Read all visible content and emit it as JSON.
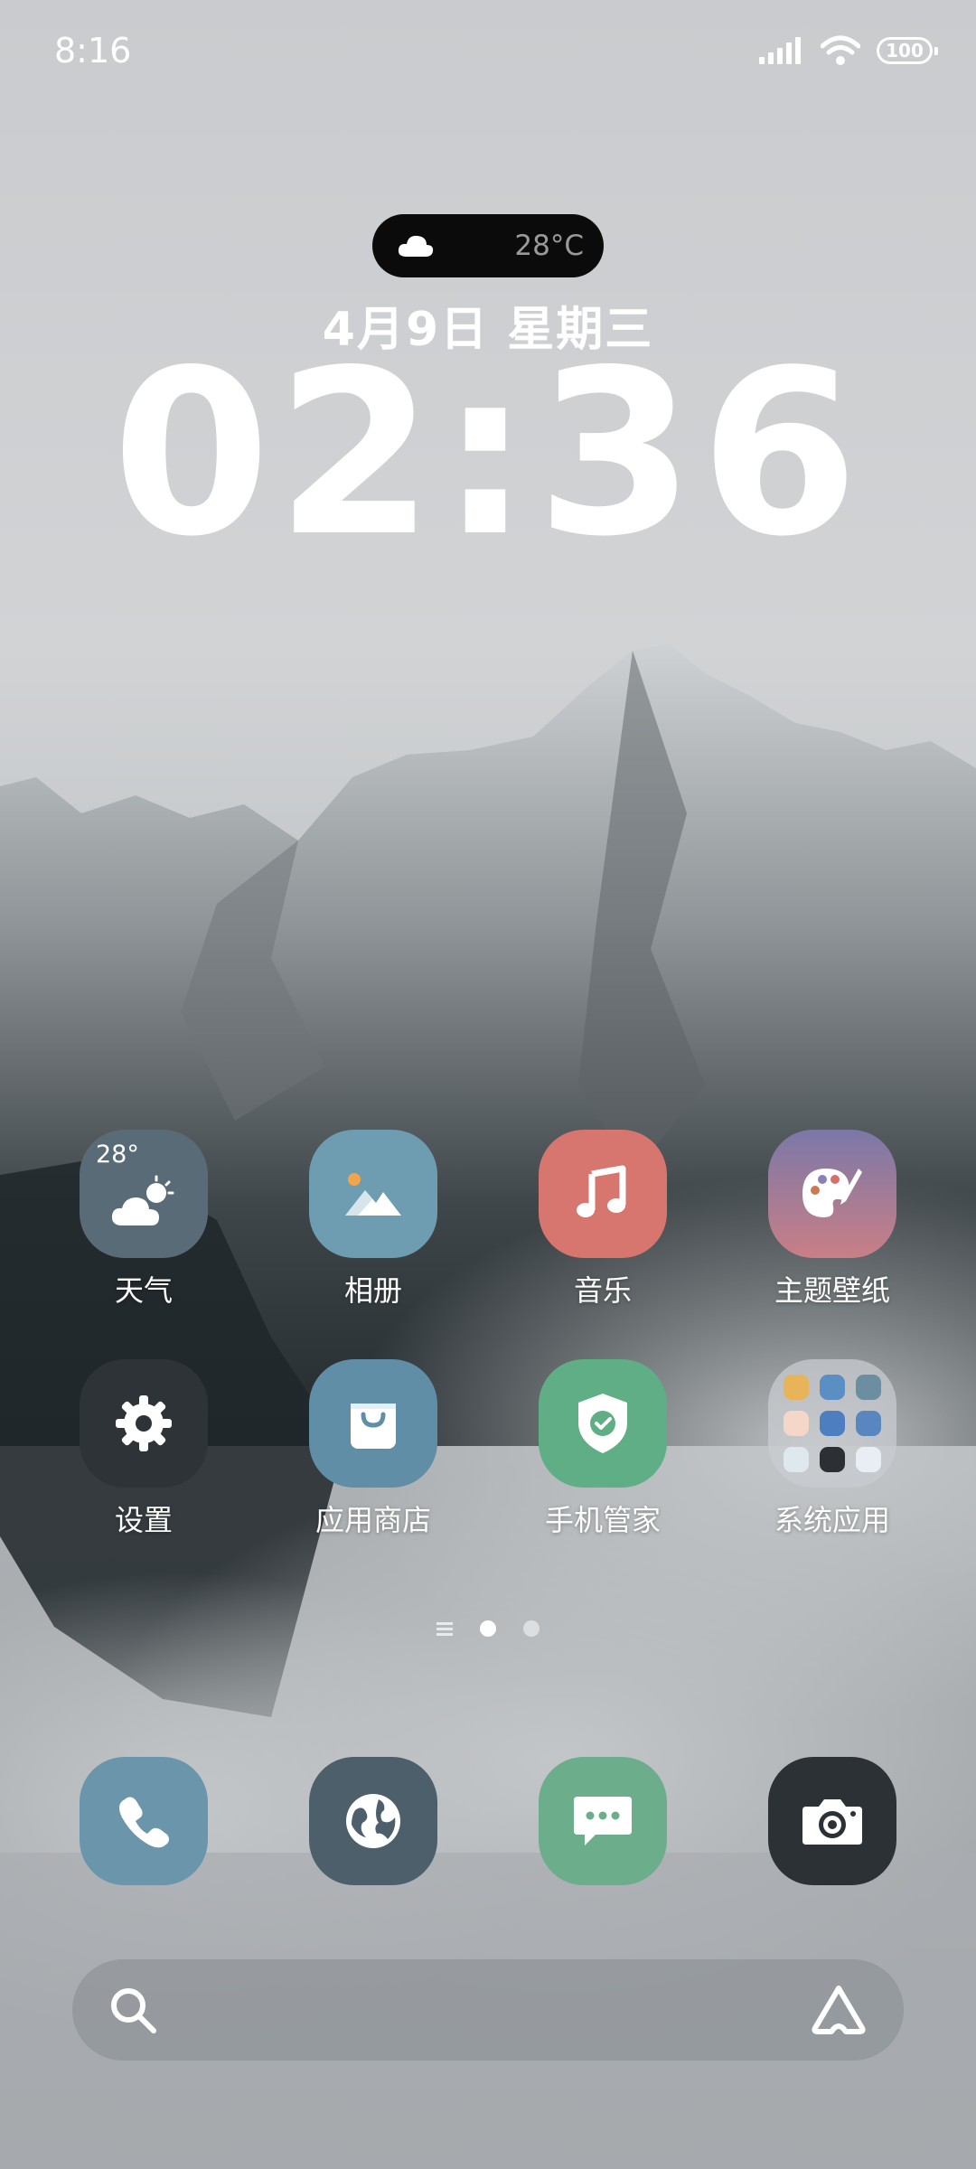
{
  "status_bar": {
    "time": "8:16",
    "battery": "100"
  },
  "lockscreen_widget": {
    "weather_temp": "28°C",
    "date": "4月9日 星期三",
    "clock": "02:36"
  },
  "apps": [
    {
      "label": "天气",
      "badge": "28°",
      "icon": "weather-icon",
      "color": "#5a6b78"
    },
    {
      "label": "相册",
      "icon": "gallery-icon",
      "color": "#6e9cb0"
    },
    {
      "label": "音乐",
      "icon": "music-icon",
      "color": "#d7766e"
    },
    {
      "label": "主题壁纸",
      "icon": "theme-palette-icon",
      "color": "#a67a9a"
    },
    {
      "label": "设置",
      "icon": "gear-icon",
      "color": "#2e3338"
    },
    {
      "label": "应用商店",
      "icon": "app-store-icon",
      "color": "#5f8ea6"
    },
    {
      "label": "手机管家",
      "icon": "shield-icon",
      "color": "#5fae86"
    },
    {
      "label": "系统应用",
      "icon": "folder-icon",
      "color": "#b4b8bc"
    }
  ],
  "pager": {
    "pages": 2,
    "current": 1
  },
  "dock": [
    {
      "name": "phone",
      "icon": "phone-icon",
      "color": "#6b95aa"
    },
    {
      "name": "browser",
      "icon": "globe-icon",
      "color": "#4d5f6b"
    },
    {
      "name": "messages",
      "icon": "message-icon",
      "color": "#6cae8b"
    },
    {
      "name": "camera",
      "icon": "camera-icon",
      "color": "#2c3136"
    }
  ],
  "search": {
    "search_icon": "search-icon",
    "assistant_icon": "assistant-icon"
  }
}
